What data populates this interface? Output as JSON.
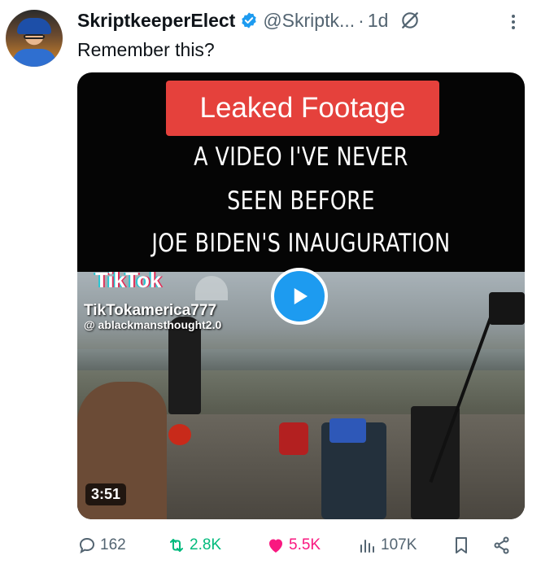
{
  "author": {
    "display_name": "SkriptkeeperElect",
    "handle": "@Skriptk...",
    "separator": "·",
    "time": "1d"
  },
  "tweet": {
    "text": "Remember this?"
  },
  "video": {
    "banner": "Leaked Footage",
    "caption_lines": [
      "A VIDEO I'VE NEVER",
      "SEEN BEFORE",
      "JOE BIDEN'S INAUGURATION"
    ],
    "tiktok_logo": "TikTok",
    "tiktok_user": "TikTokamerica777",
    "tiktok_handle": "@ ablackmansthought2.0",
    "duration": "3:51"
  },
  "actions": {
    "replies": "162",
    "reposts": "2.8K",
    "likes": "5.5K",
    "views": "107K"
  },
  "colors": {
    "verified": "#1d9bf0",
    "repost": "#00ba7c",
    "like": "#f91880",
    "muted": "#536471",
    "banner": "#e5413c"
  },
  "icons": [
    "verified-badge-icon",
    "grok-icon",
    "more-icon",
    "play-icon",
    "reply-icon",
    "repost-icon",
    "heart-icon",
    "views-icon",
    "bookmark-icon",
    "share-icon"
  ]
}
